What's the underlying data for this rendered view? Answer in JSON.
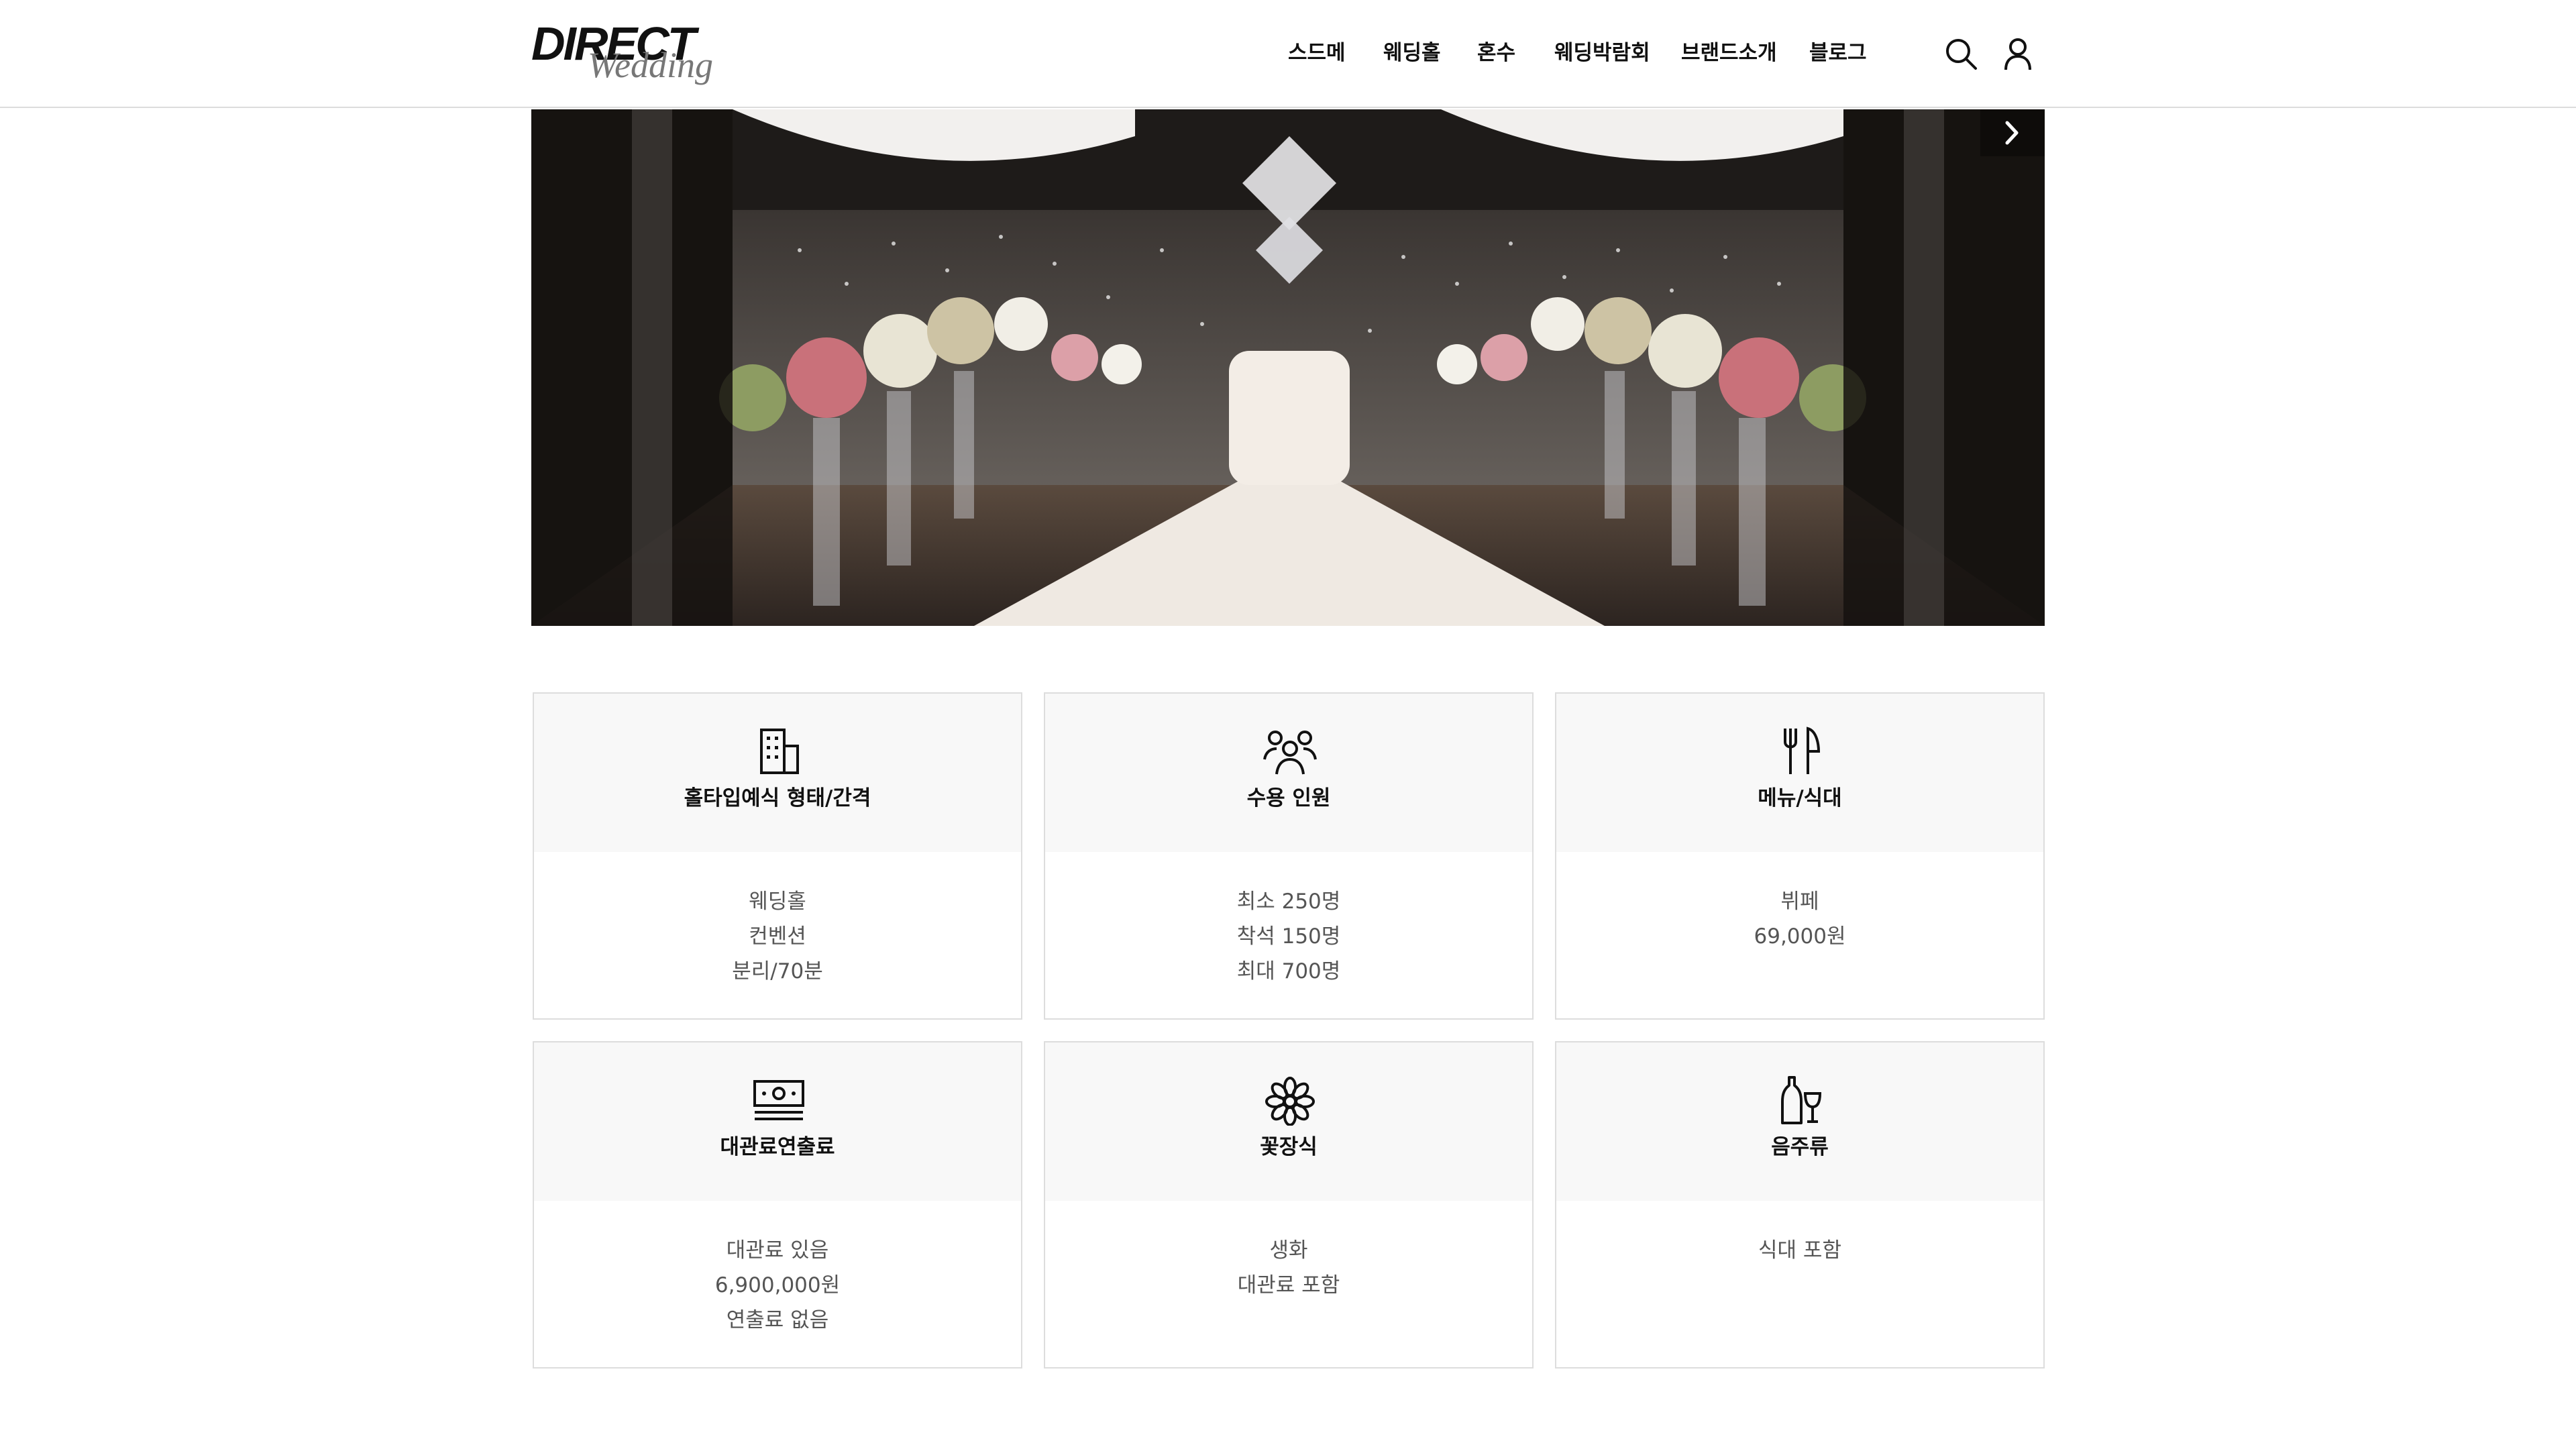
{
  "header": {
    "logo_main": "DIRECT",
    "logo_sub": "Wedding",
    "nav": [
      "스드메",
      "웨딩홀",
      "혼수",
      "웨딩박람회",
      "브랜드소개",
      "블로그"
    ],
    "icons": [
      "search-icon",
      "user-icon"
    ]
  },
  "hero": {
    "description_icon": "chevron-right-icon"
  },
  "cards": [
    {
      "icon": "building-icon",
      "title": "홀타입예식 형태/간격",
      "lines": [
        "웨딩홀",
        "컨벤션",
        "분리/70분"
      ]
    },
    {
      "icon": "people-icon",
      "title": "수용 인원",
      "lines": [
        "최소 250명",
        "착석 150명",
        "최대 700명"
      ]
    },
    {
      "icon": "fork-knife-icon",
      "title": "메뉴/식대",
      "lines": [
        "뷔페",
        "69,000원"
      ]
    },
    {
      "icon": "money-icon",
      "title": "대관료연출료",
      "lines": [
        "대관료 있음",
        "6,900,000원",
        "연출료 없음"
      ]
    },
    {
      "icon": "flower-icon",
      "title": "꽃장식",
      "lines": [
        "생화",
        "대관료 포함"
      ]
    },
    {
      "icon": "wine-icon",
      "title": "음주류",
      "lines": [
        "식대 포함"
      ]
    }
  ],
  "colors": {
    "text": "#111111",
    "muted": "#555555",
    "card_head_bg": "#f8f8f8",
    "border": "#dddddd"
  }
}
